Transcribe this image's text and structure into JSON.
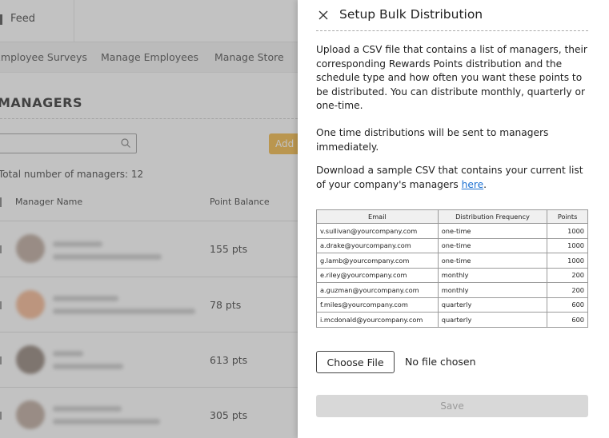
{
  "background": {
    "header": {
      "feed_label": "Feed"
    },
    "nav": {
      "items": [
        "Employee Surveys",
        "Manage Employees",
        "Manage Store"
      ]
    },
    "title": "MANAGERS",
    "add_button_label": "Add",
    "total_text": "Total number of managers: 12",
    "columns": {
      "name": "Manager Name",
      "balance": "Point Balance"
    },
    "rows": [
      {
        "points": "155 pts"
      },
      {
        "points": "78 pts"
      },
      {
        "points": "613 pts"
      },
      {
        "points": "305 pts"
      }
    ]
  },
  "drawer": {
    "title": "Setup Bulk Distribution",
    "close_icon": "close-icon",
    "paragraph1": "Upload a CSV file that contains a list of managers, their corresponding Rewards Points distribution and the schedule type and how often you want these points to be distributed. You can distribute monthly, quarterly or one-time.",
    "paragraph2": "One time distributions will be sent to managers immediately.",
    "paragraph3_text": "Download a sample CSV that contains your current list of your company's managers ",
    "paragraph3_link": "here",
    "paragraph3_end": ".",
    "table": {
      "headers": [
        "Email",
        "Distribution Frequency",
        "Points"
      ],
      "rows": [
        [
          "v.sullivan@yourcompany.com",
          "one-time",
          "1000"
        ],
        [
          "a.drake@yourcompany.com",
          "one-time",
          "1000"
        ],
        [
          "g.lamb@yourcompany.com",
          "one-time",
          "1000"
        ],
        [
          "e.riley@yourcompany.com",
          "monthly",
          "200"
        ],
        [
          "a.guzman@yourcompany.com",
          "monthly",
          "200"
        ],
        [
          "f.miles@yourcompany.com",
          "quarterly",
          "600"
        ],
        [
          "i.mcdonald@yourcompany.com",
          "quarterly",
          "600"
        ]
      ]
    },
    "choose_file_label": "Choose File",
    "file_status": "No file chosen",
    "save_label": "Save"
  },
  "colors": {
    "accent": "#f2b43a",
    "link": "#1a6fd1",
    "save_disabled_bg": "#d8d8d8",
    "overlay": "rgba(110,110,110,0.42)"
  }
}
